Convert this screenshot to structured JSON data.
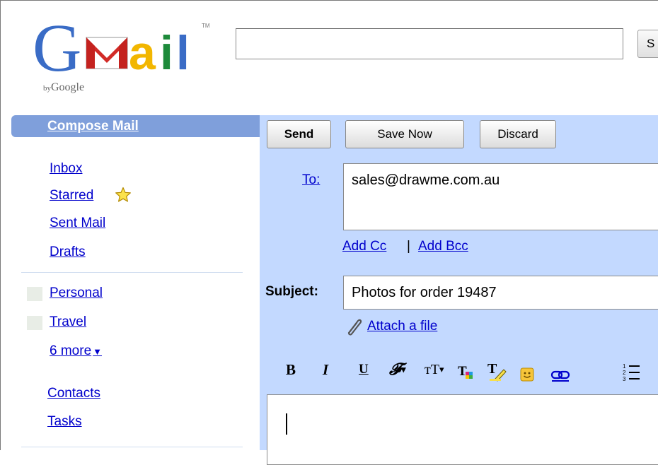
{
  "logo": {
    "letters": [
      "G",
      "M",
      "a",
      "i",
      "l"
    ],
    "byline_by": "by",
    "byline_brand": "Google",
    "trademark": "TM"
  },
  "search": {
    "value": "",
    "button_label": "S"
  },
  "nav": {
    "compose": "Compose Mail",
    "items": [
      "Inbox",
      "Starred",
      "Sent Mail",
      "Drafts"
    ],
    "labels": [
      "Personal",
      "Travel"
    ],
    "more": "6 more",
    "bottom": [
      "Contacts",
      "Tasks"
    ]
  },
  "compose": {
    "buttons": {
      "send": "Send",
      "save_now": "Save Now",
      "discard": "Discard"
    },
    "to_label": "To:",
    "to_value": "sales@drawme.com.au",
    "add_cc": "Add Cc",
    "separator": "|",
    "add_bcc": "Add Bcc",
    "subject_label": "Subject:",
    "subject_value": "Photos for order 19487",
    "attach": "Attach a file",
    "body": ""
  },
  "toolbar": {
    "bold": "B",
    "italic": "I",
    "underline": "U",
    "font": "𝓕",
    "size": "тT",
    "icons": [
      "text-color-icon",
      "highlight-icon",
      "emoticon-icon",
      "link-icon",
      "numbered-list-icon"
    ]
  },
  "colors": {
    "link": "#0000cc",
    "compose_tab": "#7f9fdb",
    "compose_panel": "#c3d9ff"
  }
}
